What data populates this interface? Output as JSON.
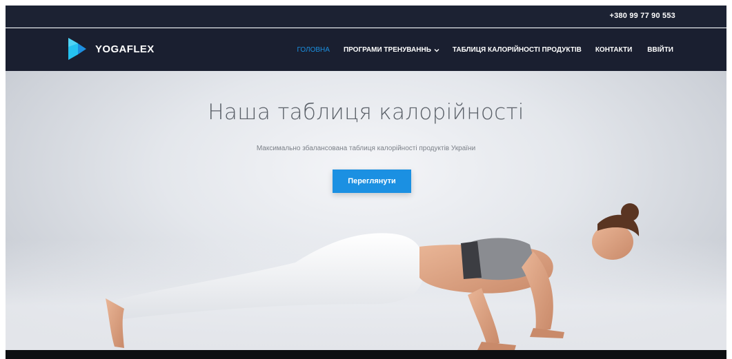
{
  "topbar": {
    "phone": "+380 99 77 90 553"
  },
  "brand": {
    "name": "YOGAFLEX",
    "logo_icon": "ribbon-logo-icon",
    "logo_colors": [
      "#25c2f0",
      "#1e8fe0"
    ]
  },
  "nav": {
    "items": [
      {
        "label": "ГОЛОВНА",
        "active": true
      },
      {
        "label": "ПРОГРАМИ ТРЕНУВАННЬ",
        "active": false,
        "has_dropdown": true
      },
      {
        "label": "ТАБЛИЦЯ КАЛОРІЙНОСТІ ПРОДУКТІВ",
        "active": false
      },
      {
        "label": "КОНТАКТИ",
        "active": false
      },
      {
        "label": "ВВІЙТИ",
        "active": false
      }
    ],
    "dropdown_icon": "chevron-down-icon"
  },
  "hero": {
    "title": "Наша таблиця калорійності",
    "subtitle": "Максимально збалансована таблиця калорійності продуктів України",
    "cta_label": "Переглянути"
  },
  "colors": {
    "topbar_bg": "#1c2233",
    "navbar_bg": "#1a1f30",
    "accent": "#1b90e2",
    "footer": "#0e0f12"
  }
}
